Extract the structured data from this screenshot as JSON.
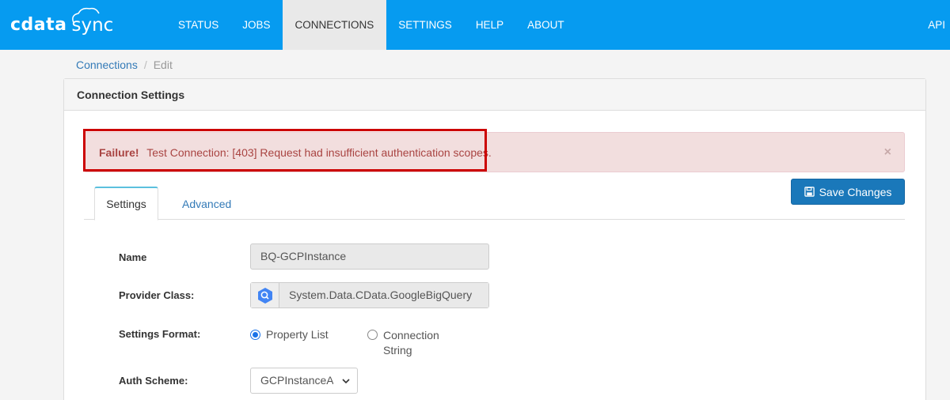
{
  "brand": {
    "name_bold": "cdata",
    "name_light": "sync"
  },
  "nav": {
    "items": [
      {
        "label": "STATUS"
      },
      {
        "label": "JOBS"
      },
      {
        "label": "CONNECTIONS"
      },
      {
        "label": "SETTINGS"
      },
      {
        "label": "HELP"
      },
      {
        "label": "ABOUT"
      }
    ],
    "active": "CONNECTIONS",
    "right_label": "API"
  },
  "breadcrumb": {
    "link": "Connections",
    "separator": "/",
    "current": "Edit"
  },
  "panel": {
    "title": "Connection Settings"
  },
  "alert": {
    "strong": "Failure!",
    "message": "Test Connection: [403] Request had insufficient authentication scopes.",
    "close": "×"
  },
  "tabs": [
    {
      "label": "Settings"
    },
    {
      "label": "Advanced"
    }
  ],
  "save_button": {
    "label": "Save Changes"
  },
  "form": {
    "name_label": "Name",
    "name_value": "BQ-GCPInstance",
    "provider_label": "Provider Class:",
    "provider_value": "System.Data.CData.GoogleBigQuery",
    "format_label": "Settings Format:",
    "format_options": [
      {
        "label": "Property List",
        "checked": true
      },
      {
        "label_line1": "Connection",
        "label_line2": "String",
        "checked": false
      }
    ],
    "auth_label": "Auth Scheme:",
    "auth_value": "GCPInstanceAccount"
  },
  "colors": {
    "navbar": "#069bf0",
    "alert_bg": "#f2dede",
    "alert_text": "#a94442",
    "highlight": "#cc0000",
    "primary_button": "#1a78ba"
  }
}
